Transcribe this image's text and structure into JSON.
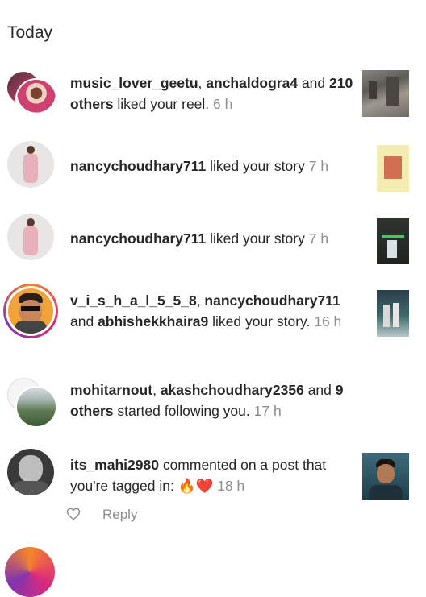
{
  "section": {
    "title": "Today"
  },
  "notifications": [
    {
      "users": [
        "music_lover_geetu",
        "anchaldogra4"
      ],
      "others": "210 others",
      "action": "liked your reel.",
      "time": "6 h"
    },
    {
      "user": "nancychoudhary711",
      "action": "liked your story",
      "time": "7 h"
    },
    {
      "user": "nancychoudhary711",
      "action": "liked your story",
      "time": "7 h"
    },
    {
      "users": [
        "v_i_s_h_a_l_5_5_8",
        "nancychoudhary711",
        "abhishekkhaira9"
      ],
      "action": "liked your story.",
      "time": "16 h"
    },
    {
      "users": [
        "mohitarnout",
        "akashchoudhary2356"
      ],
      "others": "9 others",
      "action": "started following you.",
      "time": "17 h"
    },
    {
      "user": "its_mahi2980",
      "action": "commented on a post that you're tagged in:",
      "emoji": "🔥❤️",
      "time": "18 h",
      "reply_label": "Reply"
    }
  ],
  "icons": {
    "like": "heart-outline-icon"
  },
  "colors": {
    "text": "#262626",
    "secondary": "#8e8e8e",
    "story_ring": [
      "#f58529",
      "#dd2a7b",
      "#8134af"
    ]
  }
}
